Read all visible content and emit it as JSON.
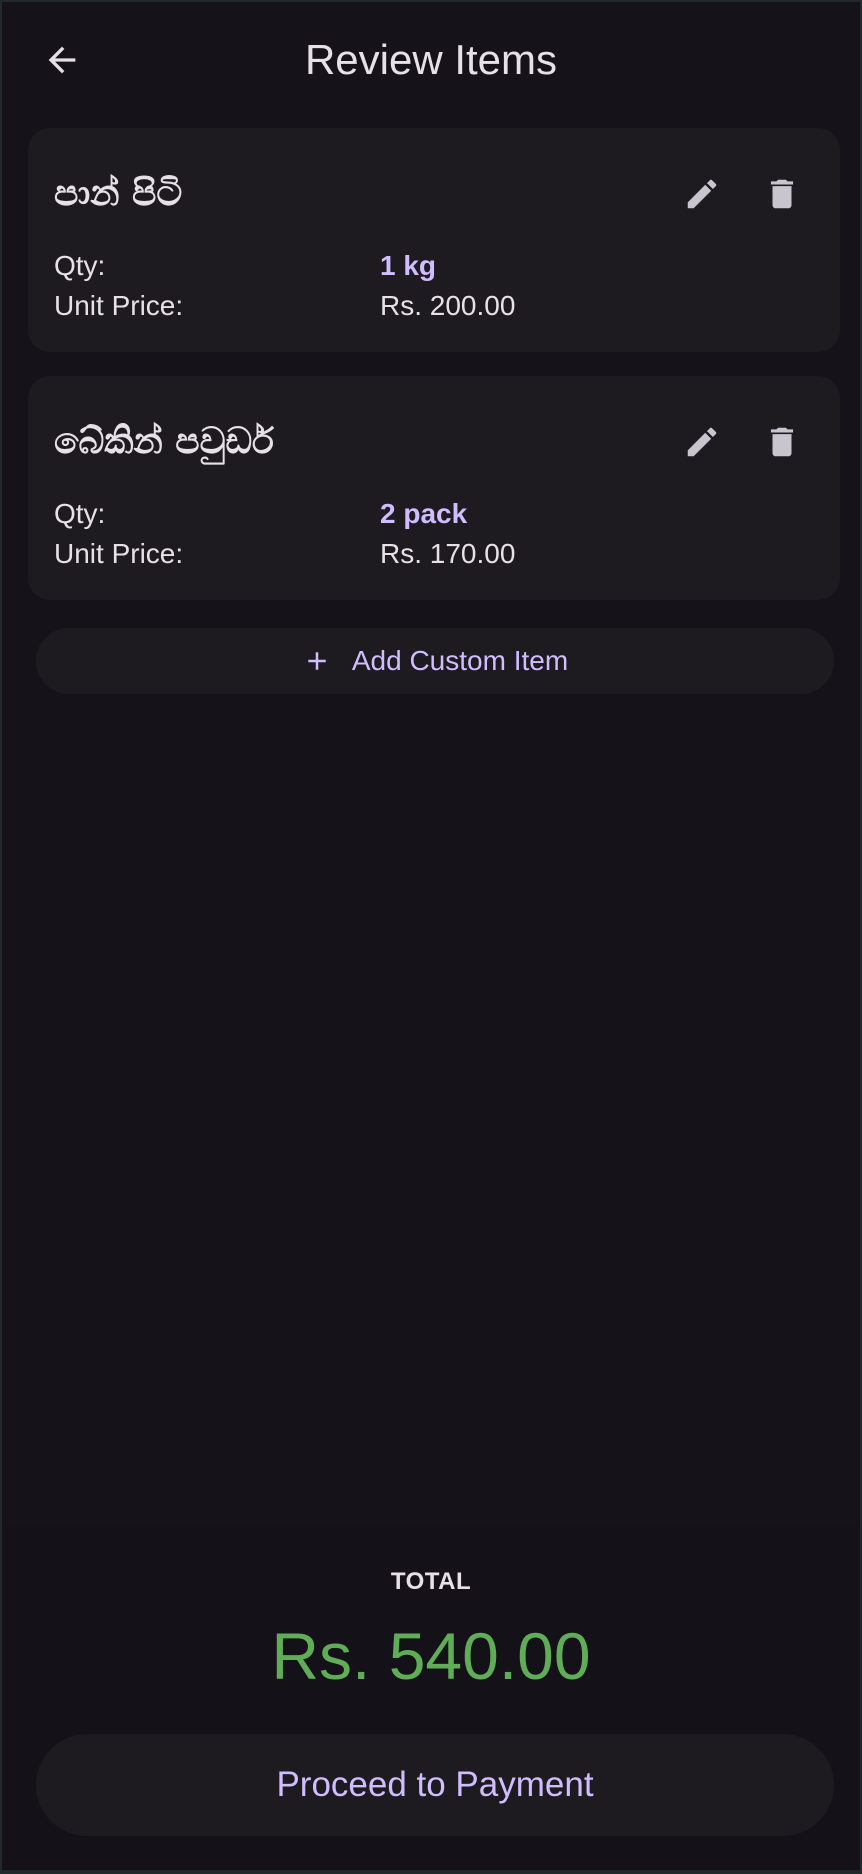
{
  "app_bar": {
    "title": "Review Items",
    "back_icon": "arrow-back-icon"
  },
  "items": [
    {
      "name": "පාන් පිටි",
      "qty_label": "Qty:",
      "qty_value": "1 kg",
      "price_label": "Unit Price:",
      "price_value": "Rs. 200.00",
      "edit_icon": "pencil-icon",
      "delete_icon": "trash-icon"
    },
    {
      "name": "බේකින් පවුඩර්",
      "qty_label": "Qty:",
      "qty_value": "2 pack",
      "price_label": "Unit Price:",
      "price_value": "Rs. 170.00",
      "edit_icon": "pencil-icon",
      "delete_icon": "trash-icon"
    }
  ],
  "add_custom": {
    "label": "Add Custom Item",
    "icon": "plus-icon"
  },
  "summary": {
    "total_label": "TOTAL",
    "total_value": "Rs. 540.00"
  },
  "proceed": {
    "label": "Proceed to Payment"
  },
  "colors": {
    "background": "#151319",
    "card": "#1d1b20",
    "accent": "#d0bcff",
    "text": "#e6e0e9",
    "total": "#5fad56",
    "icon": "#c9c5cf"
  }
}
